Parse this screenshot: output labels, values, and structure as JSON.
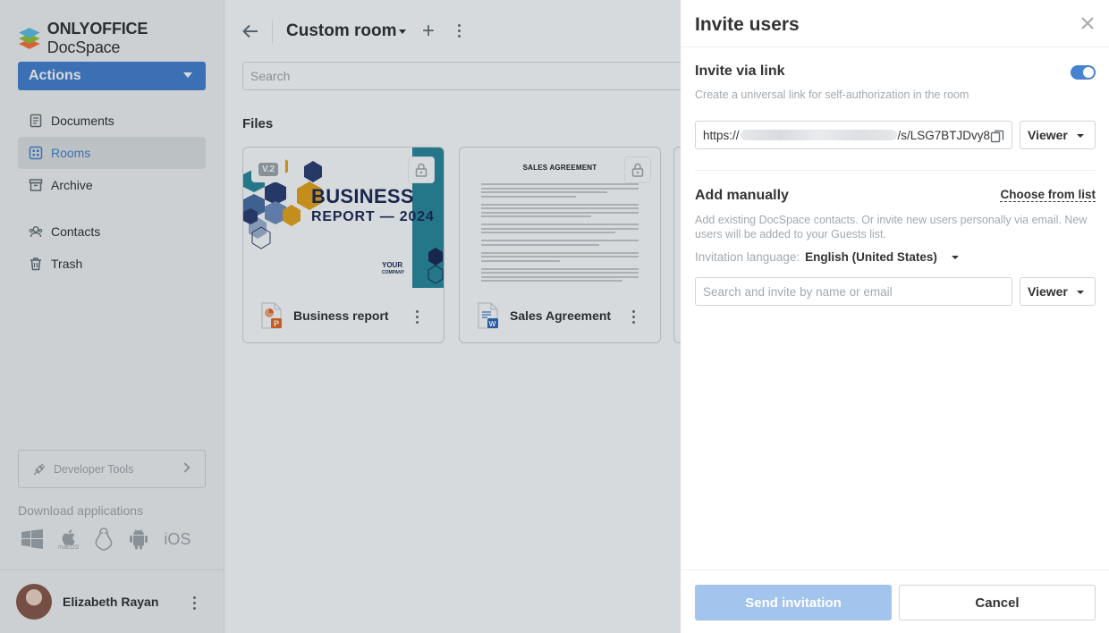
{
  "brand": {
    "name_bold": "ONLYOFFICE",
    "name_rest": " DocSpace"
  },
  "sidebar": {
    "actions_label": "Actions",
    "items": [
      {
        "label": "Documents",
        "icon": "document-icon"
      },
      {
        "label": "Rooms",
        "icon": "rooms-icon",
        "active": true
      },
      {
        "label": "Archive",
        "icon": "archive-icon"
      },
      {
        "label": "Contacts",
        "icon": "contacts-icon"
      },
      {
        "label": "Trash",
        "icon": "trash-icon"
      }
    ],
    "developer_tools_label": "Developer Tools",
    "download_label": "Download applications",
    "download_apps": [
      "windows-icon",
      "macos-icon",
      "linux-icon",
      "android-icon"
    ],
    "ios_label": "iOS",
    "macos_label": "macOS",
    "user_name": "Elizabeth Rayan"
  },
  "main": {
    "room_title": "Custom room",
    "search_placeholder": "Search",
    "files_label": "Files",
    "files": [
      {
        "name": "Business report",
        "type": "presentation",
        "version_badge": "V.2",
        "thumb_title": "BUSINESS",
        "thumb_subtitle": "REPORT — 2024",
        "thumb_company_1": "YOUR",
        "thumb_company_2": "COMPANY",
        "accent": "#e8a51a",
        "band": "#2a8a9c"
      },
      {
        "name": "Sales Agreement",
        "type": "document",
        "thumb_title": "SALES AGREEMENT"
      }
    ]
  },
  "invite": {
    "title": "Invite users",
    "via_link_title": "Invite via link",
    "via_link_desc": "Create a universal link for self-authorization in the room",
    "link_prefix": "https://",
    "link_suffix": "/s/LSG7BTJDvy8:",
    "link_enabled": true,
    "link_role": "Viewer",
    "manual_title": "Add manually",
    "choose_from_list": "Choose from list",
    "manual_desc": "Add existing DocSpace contacts. Or invite new users personally via email. New users will be added to your Guests list.",
    "language_label": "Invitation language:",
    "language_value": "English (United States)",
    "search_placeholder": "Search and invite by name or email",
    "manual_role": "Viewer",
    "send_label": "Send invitation",
    "cancel_label": "Cancel"
  },
  "colors": {
    "accent": "#4781d1",
    "send_disabled": "#a3c4ec",
    "muted_text": "#a3a9ae"
  }
}
